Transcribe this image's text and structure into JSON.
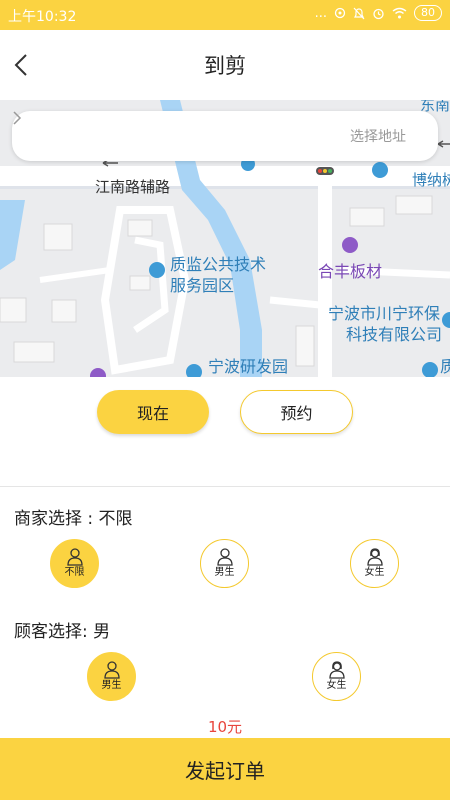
{
  "status_bar": {
    "time": "上午10:32",
    "dots": "...",
    "battery": "80"
  },
  "header": {
    "title": "到剪"
  },
  "map": {
    "address_placeholder": "选择地址",
    "labels": {
      "jiangnan_road": "江南路辅路",
      "zhijian_line1": "质监公共技术",
      "zhijian_line2": "服务园区",
      "hefeng": "合丰板材",
      "chuanning_line1": "宁波市川宁环保",
      "chuanning_line2": "科技有限公司",
      "yanfa": "宁波研发园",
      "bona": "博纳树",
      "dongnan": "东南",
      "zhi_right": "质"
    }
  },
  "time_options": {
    "now": "现在",
    "book": "预约"
  },
  "merchant": {
    "label": "商家选择 : 不限",
    "options": [
      {
        "label": "不限",
        "selected": true
      },
      {
        "label": "男生",
        "selected": false
      },
      {
        "label": "女生",
        "selected": false
      }
    ]
  },
  "customer": {
    "label": "顾客选择: 男",
    "options": [
      {
        "label": "男生",
        "selected": true
      },
      {
        "label": "女生",
        "selected": false
      }
    ]
  },
  "price": "10元",
  "submit_label": "发起订单",
  "colors": {
    "accent": "#FBD341",
    "price": "#E8453C"
  }
}
